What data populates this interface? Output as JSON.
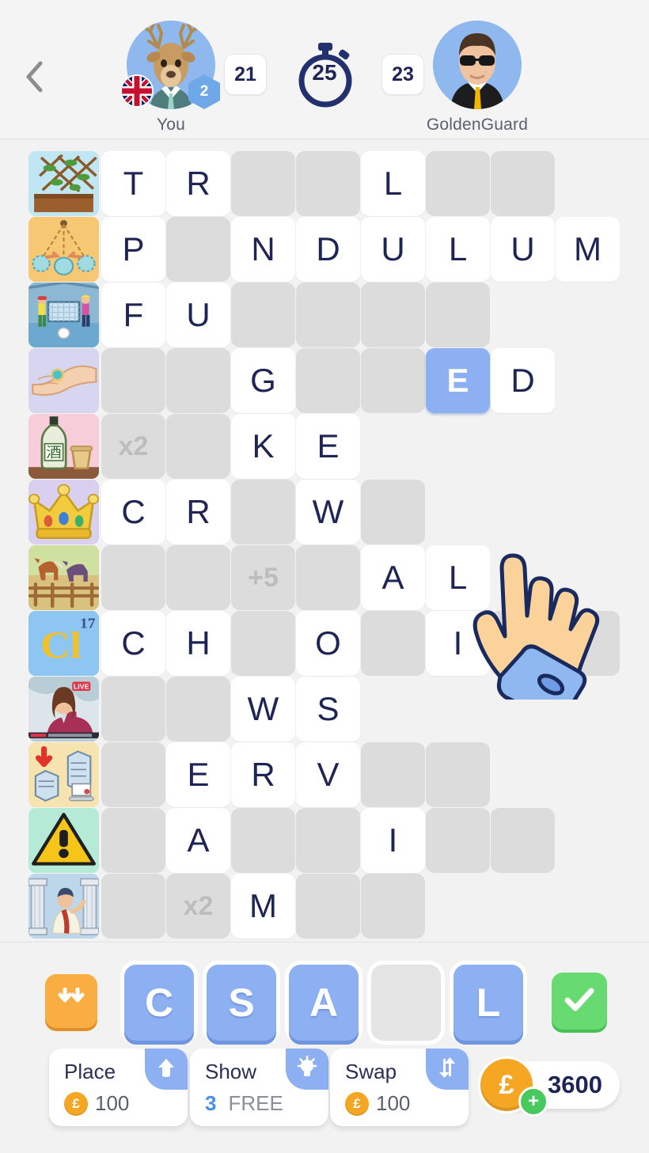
{
  "header": {
    "back_icon": "chevron-left-icon",
    "left_player": {
      "name": "You",
      "avatar_icon": "deer-avatar",
      "flag_icon": "uk-flag-icon",
      "level": "2",
      "score": "21"
    },
    "right_player": {
      "name": "GoldenGuard",
      "avatar_icon": "man-sunglasses-avatar",
      "score": "23"
    },
    "timer": {
      "icon": "stopwatch-icon",
      "value": "25"
    }
  },
  "grid": {
    "columns": 8,
    "rows": [
      {
        "clue_icon": "trellis-plant-icon",
        "clue_bg": "#bfe6f2",
        "cells": [
          {
            "t": "T",
            "s": "filled"
          },
          {
            "t": "R",
            "s": "filled"
          },
          {
            "t": "",
            "s": "empty"
          },
          {
            "t": "",
            "s": "empty"
          },
          {
            "t": "L",
            "s": "filled"
          },
          {
            "t": "",
            "s": "empty"
          },
          {
            "t": "",
            "s": "empty"
          },
          {
            "t": "",
            "s": "none"
          }
        ]
      },
      {
        "clue_icon": "pendulum-icon",
        "clue_bg": "#f7c873",
        "cells": [
          {
            "t": "P",
            "s": "filled"
          },
          {
            "t": "",
            "s": "empty"
          },
          {
            "t": "N",
            "s": "filled"
          },
          {
            "t": "D",
            "s": "filled"
          },
          {
            "t": "U",
            "s": "filled"
          },
          {
            "t": "L",
            "s": "filled"
          },
          {
            "t": "U",
            "s": "filled"
          },
          {
            "t": "M",
            "s": "filled"
          }
        ]
      },
      {
        "clue_icon": "futsal-goal-icon",
        "clue_bg": "#a8cfe8",
        "cells": [
          {
            "t": "F",
            "s": "filled"
          },
          {
            "t": "U",
            "s": "filled"
          },
          {
            "t": "",
            "s": "empty"
          },
          {
            "t": "",
            "s": "empty"
          },
          {
            "t": "",
            "s": "empty"
          },
          {
            "t": "",
            "s": "empty"
          },
          {
            "t": "",
            "s": "none"
          },
          {
            "t": "",
            "s": "none"
          }
        ]
      },
      {
        "clue_icon": "hand-ring-icon",
        "clue_bg": "#d6d6f0",
        "cells": [
          {
            "t": "",
            "s": "empty"
          },
          {
            "t": "",
            "s": "empty"
          },
          {
            "t": "G",
            "s": "filled"
          },
          {
            "t": "",
            "s": "empty"
          },
          {
            "t": "",
            "s": "empty"
          },
          {
            "t": "E",
            "s": "active"
          },
          {
            "t": "D",
            "s": "filled"
          },
          {
            "t": "",
            "s": "none"
          }
        ]
      },
      {
        "clue_icon": "sake-bottle-icon",
        "clue_bg": "#f7cdd9",
        "cells": [
          {
            "t": "x2",
            "s": "empty bonus"
          },
          {
            "t": "",
            "s": "empty"
          },
          {
            "t": "K",
            "s": "filled"
          },
          {
            "t": "E",
            "s": "filled"
          },
          {
            "t": "",
            "s": "none"
          },
          {
            "t": "",
            "s": "none"
          },
          {
            "t": "",
            "s": "none"
          },
          {
            "t": "",
            "s": "none"
          }
        ]
      },
      {
        "clue_icon": "crown-icon",
        "clue_bg": "#d9d0ef",
        "cells": [
          {
            "t": "C",
            "s": "filled"
          },
          {
            "t": "R",
            "s": "filled"
          },
          {
            "t": "",
            "s": "empty"
          },
          {
            "t": "W",
            "s": "filled"
          },
          {
            "t": "",
            "s": "empty"
          },
          {
            "t": "",
            "s": "none"
          },
          {
            "t": "",
            "s": "none"
          },
          {
            "t": "",
            "s": "none"
          }
        ]
      },
      {
        "clue_icon": "horse-paddock-icon",
        "clue_bg": "#dbe8b6",
        "cells": [
          {
            "t": "",
            "s": "empty"
          },
          {
            "t": "",
            "s": "empty"
          },
          {
            "t": "+5",
            "s": "empty bonus"
          },
          {
            "t": "",
            "s": "empty"
          },
          {
            "t": "A",
            "s": "filled"
          },
          {
            "t": "L",
            "s": "filled"
          },
          {
            "t": "",
            "s": "none"
          },
          {
            "t": "",
            "s": "none"
          }
        ]
      },
      {
        "clue_icon": "chlorine-element-icon",
        "clue_bg": "#8ec6f2",
        "cells": [
          {
            "t": "C",
            "s": "filled"
          },
          {
            "t": "H",
            "s": "filled"
          },
          {
            "t": "",
            "s": "empty"
          },
          {
            "t": "O",
            "s": "filled"
          },
          {
            "t": "",
            "s": "empty"
          },
          {
            "t": "I",
            "s": "filled"
          },
          {
            "t": "",
            "s": "empty"
          },
          {
            "t": "",
            "s": "empty"
          }
        ]
      },
      {
        "clue_icon": "news-anchor-live-icon",
        "clue_bg": "#c9d8df",
        "cells": [
          {
            "t": "",
            "s": "empty"
          },
          {
            "t": "",
            "s": "empty"
          },
          {
            "t": "W",
            "s": "filled"
          },
          {
            "t": "S",
            "s": "filled"
          },
          {
            "t": "",
            "s": "none"
          },
          {
            "t": "",
            "s": "none"
          },
          {
            "t": "",
            "s": "none"
          },
          {
            "t": "",
            "s": "none"
          }
        ]
      },
      {
        "clue_icon": "server-backup-icon",
        "clue_bg": "#f7e3b0",
        "cells": [
          {
            "t": "",
            "s": "empty"
          },
          {
            "t": "E",
            "s": "filled"
          },
          {
            "t": "R",
            "s": "filled"
          },
          {
            "t": "V",
            "s": "filled"
          },
          {
            "t": "",
            "s": "empty"
          },
          {
            "t": "",
            "s": "empty"
          },
          {
            "t": "",
            "s": "none"
          },
          {
            "t": "",
            "s": "none"
          }
        ]
      },
      {
        "clue_icon": "warning-triangle-icon",
        "clue_bg": "#b5ead6",
        "cells": [
          {
            "t": "",
            "s": "empty"
          },
          {
            "t": "A",
            "s": "filled"
          },
          {
            "t": "",
            "s": "empty"
          },
          {
            "t": "",
            "s": "empty"
          },
          {
            "t": "I",
            "s": "filled"
          },
          {
            "t": "",
            "s": "empty"
          },
          {
            "t": "",
            "s": "empty"
          },
          {
            "t": "",
            "s": "none"
          }
        ]
      },
      {
        "clue_icon": "roman-orator-icon",
        "clue_bg": "#bcd6ea",
        "cells": [
          {
            "t": "",
            "s": "empty"
          },
          {
            "t": "x2",
            "s": "empty bonus"
          },
          {
            "t": "M",
            "s": "filled"
          },
          {
            "t": "",
            "s": "empty"
          },
          {
            "t": "",
            "s": "empty"
          },
          {
            "t": "",
            "s": "none"
          },
          {
            "t": "",
            "s": "none"
          },
          {
            "t": "",
            "s": "none"
          }
        ]
      }
    ]
  },
  "rack": {
    "shuffle_icon": "double-down-arrow-icon",
    "submit_icon": "check-icon",
    "tiles": [
      {
        "letter": "C",
        "blank": false
      },
      {
        "letter": "S",
        "blank": false
      },
      {
        "letter": "A",
        "blank": false
      },
      {
        "letter": "",
        "blank": true
      },
      {
        "letter": "L",
        "blank": false
      }
    ]
  },
  "powerups": [
    {
      "title": "Place",
      "icon": "up-arrow-icon",
      "cost": "100",
      "free": null
    },
    {
      "title": "Show",
      "icon": "lightbulb-icon",
      "cost": null,
      "free_count": "3",
      "free_label": "FREE"
    },
    {
      "title": "Swap",
      "icon": "swap-arrows-icon",
      "cost": "100",
      "free": null
    }
  ],
  "wallet": {
    "coin_symbol": "£",
    "amount": "3600",
    "plus_icon": "plus-icon"
  },
  "colors": {
    "accent_blue": "#8db0f2",
    "tile_white": "#ffffff",
    "cell_grey": "#dcdcdc",
    "letter_navy": "#1e2454",
    "coin_orange": "#f5a623",
    "success_green": "#67db72",
    "shuffle_orange": "#f9ad43",
    "page_bg": "#f2f2f2"
  },
  "pointer": {
    "icon": "pointing-hand-icon"
  }
}
